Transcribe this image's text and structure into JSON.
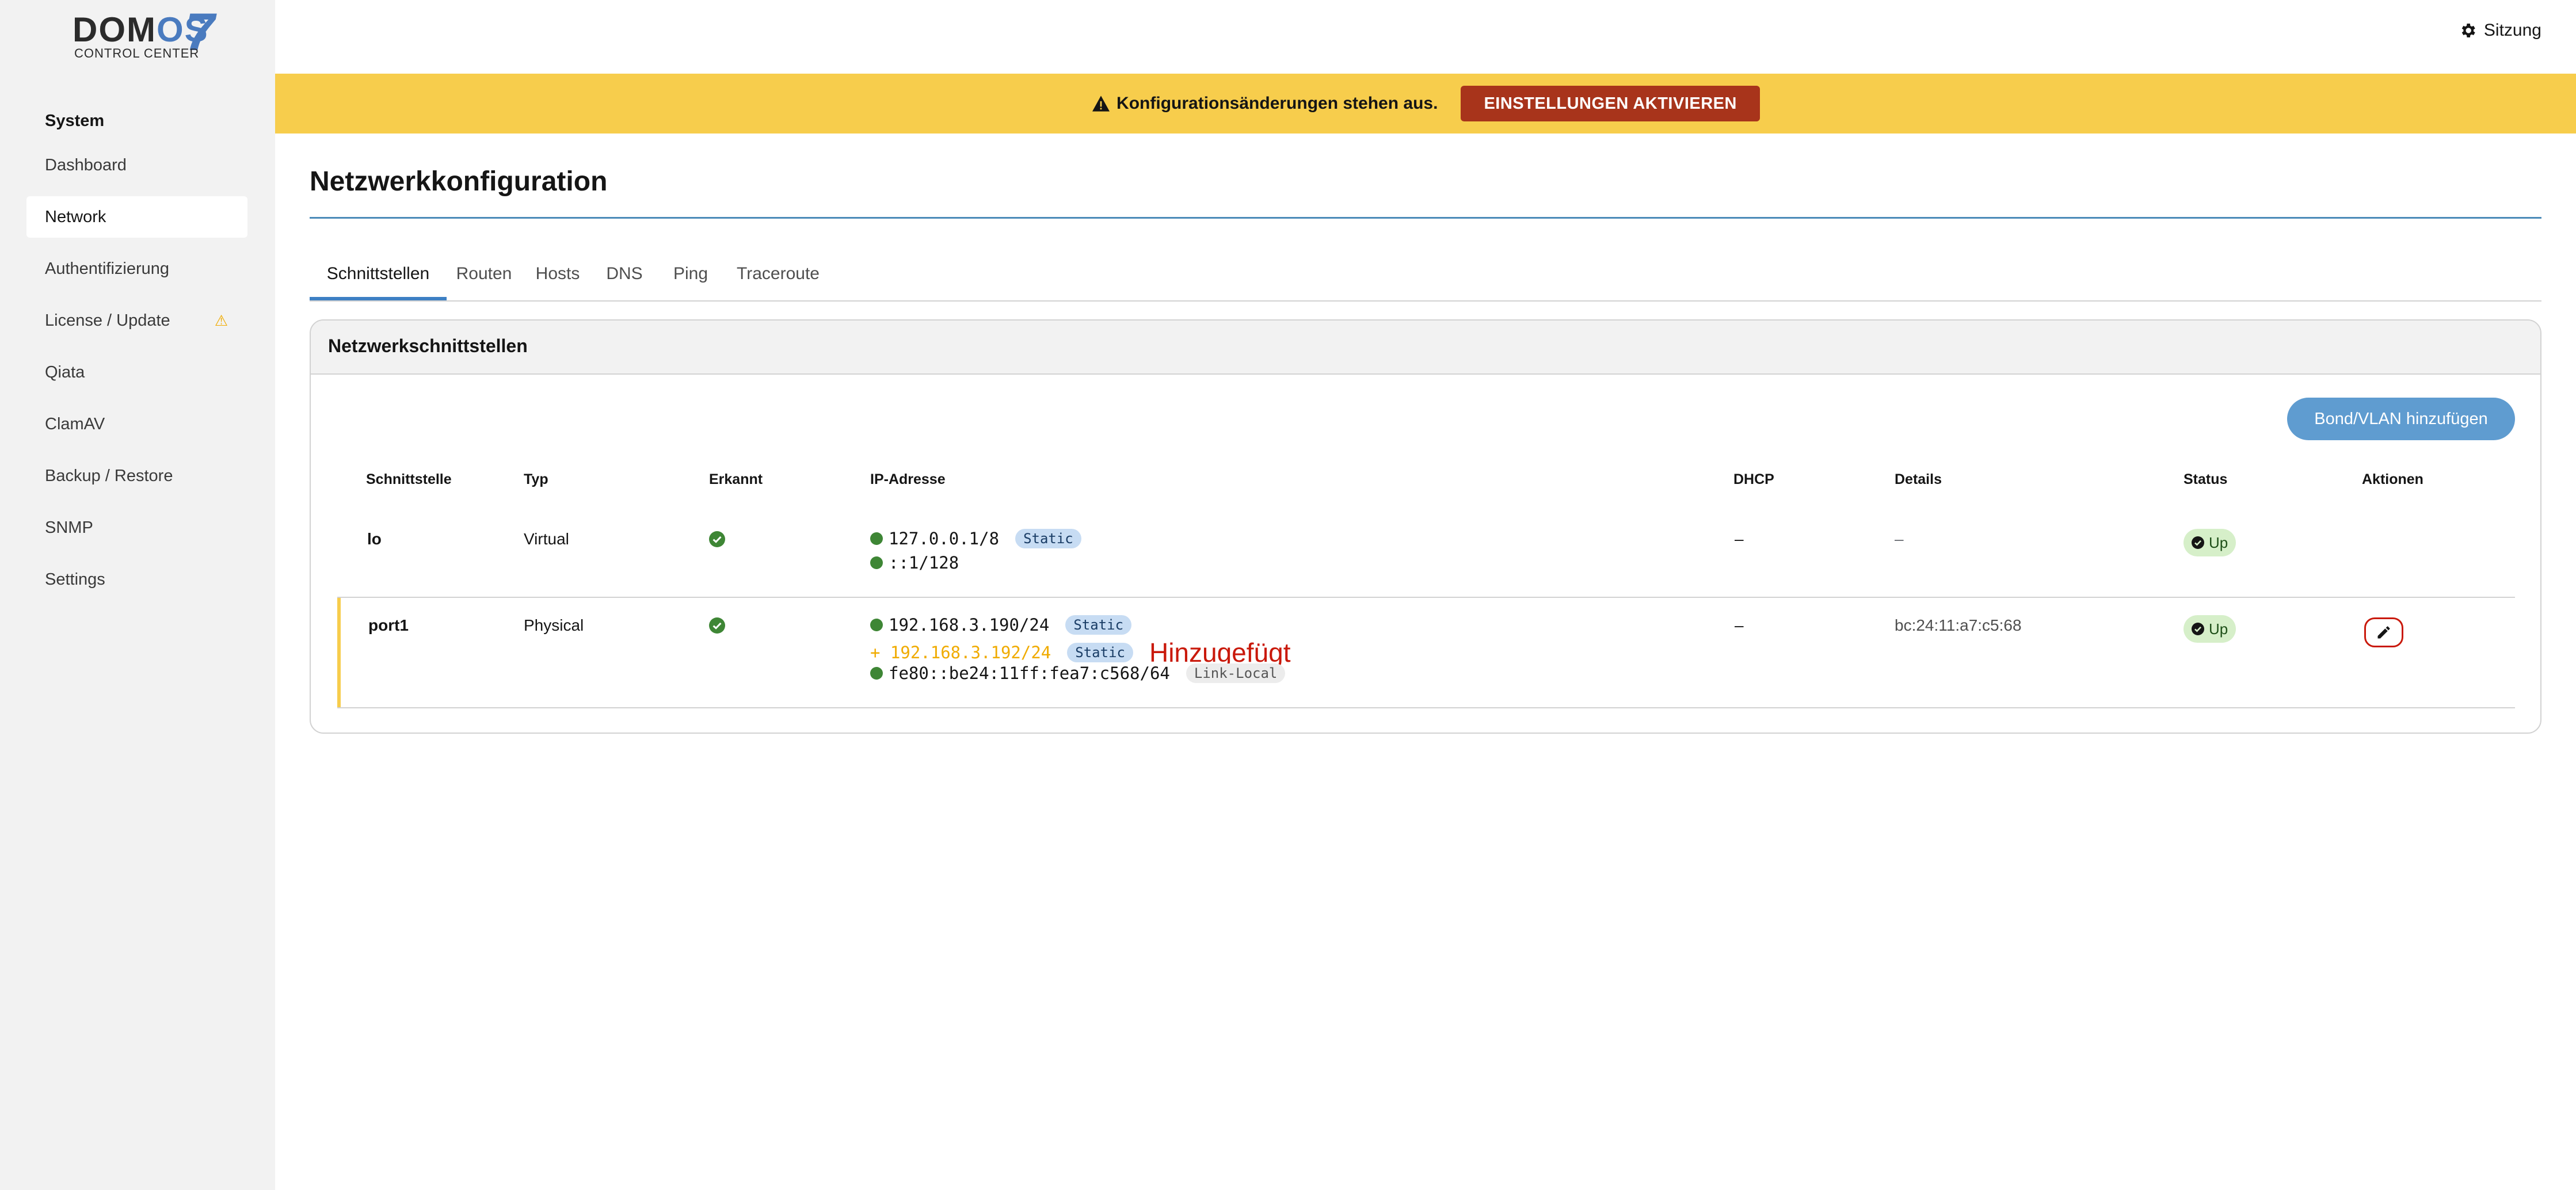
{
  "logo": {
    "brand": "DOMOS",
    "brand_accent": "OS",
    "version": "7",
    "subtitle": "CONTROL CENTER"
  },
  "sidebar": {
    "group": "System",
    "items": [
      {
        "label": "Dashboard",
        "active": false
      },
      {
        "label": "Network",
        "active": true
      },
      {
        "label": "Authentifizierung",
        "active": false
      },
      {
        "label": "License / Update",
        "active": false,
        "warning_icon": "warning-icon"
      },
      {
        "label": "Qiata",
        "active": false
      },
      {
        "label": "ClamAV",
        "active": false
      },
      {
        "label": "Backup / Restore",
        "active": false
      },
      {
        "label": "SNMP",
        "active": false
      },
      {
        "label": "Settings",
        "active": false
      }
    ]
  },
  "header": {
    "session_label": "Sitzung",
    "session_icon": "gear-icon"
  },
  "alert": {
    "message": "Konfigurationsänderungen stehen aus.",
    "icon": "warning-icon",
    "button_label": "EINSTELLUNGEN AKTIVIEREN",
    "color": "#f7cd4c",
    "button_color": "#a8341b"
  },
  "page": {
    "title": "Netzwerkkonfiguration"
  },
  "tabs": [
    {
      "label": "Schnittstellen",
      "active": true
    },
    {
      "label": "Routen"
    },
    {
      "label": "Hosts"
    },
    {
      "label": "DNS"
    },
    {
      "label": "Ping"
    },
    {
      "label": "Traceroute"
    }
  ],
  "card": {
    "title": "Netzwerkschnittstellen",
    "add_button": "Bond/VLAN hinzufügen"
  },
  "table": {
    "columns": [
      "Schnittstelle",
      "Typ",
      "Erkannt",
      "IP-Adresse",
      "DHCP",
      "Details",
      "Status",
      "Aktionen"
    ],
    "rows": [
      {
        "name": "lo",
        "type": "Virtual",
        "detected": true,
        "ips": [
          {
            "address": "127.0.0.1/8",
            "badge": "Static"
          },
          {
            "address": "::1/128"
          }
        ],
        "dhcp": "–",
        "details": "–",
        "status": "Up"
      },
      {
        "name": "port1",
        "type": "Physical",
        "detected": true,
        "ips": [
          {
            "address": "192.168.3.190/24",
            "badge": "Static"
          },
          {
            "address": "+ 192.168.3.192/24",
            "badge": "Static",
            "pending": true,
            "note": "Hinzugefügt"
          },
          {
            "address": "fe80::be24:11ff:fea7:c568/64",
            "badge": "Link-Local"
          }
        ],
        "dhcp": "–",
        "details": "bc:24:11:a7:c5:68",
        "status": "Up",
        "action_icon": "pencil-icon"
      }
    ]
  }
}
